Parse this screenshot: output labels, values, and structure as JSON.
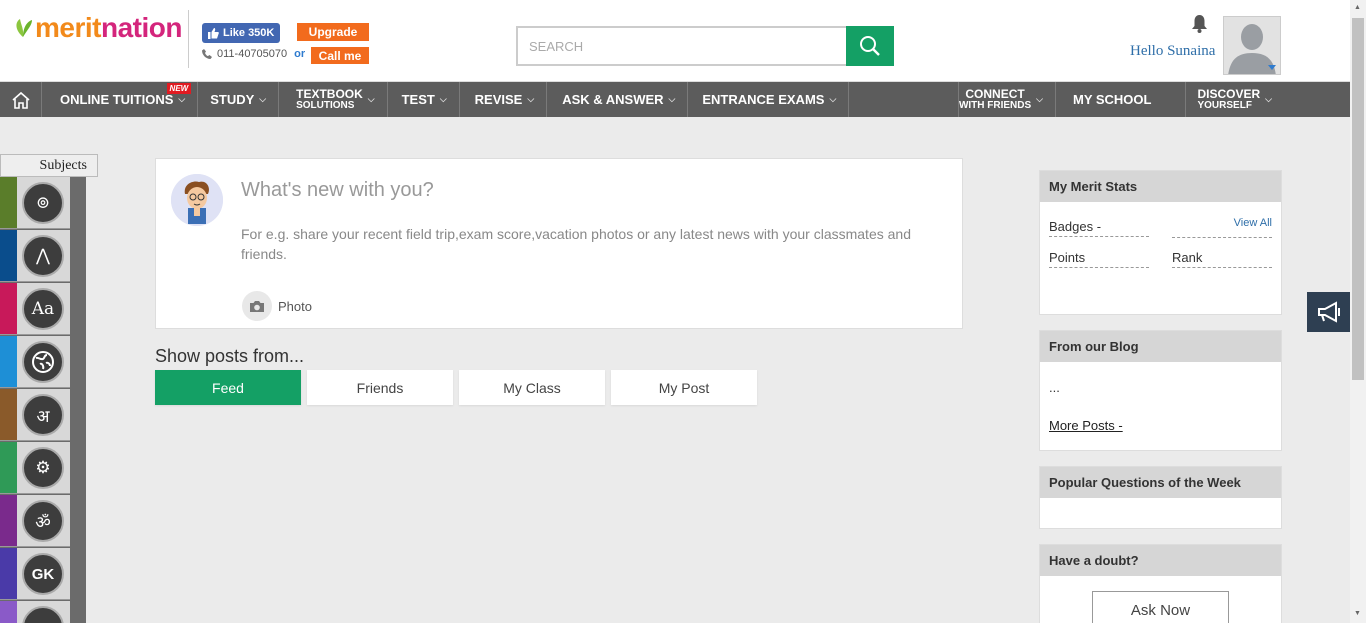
{
  "header": {
    "logo_part1": "merit",
    "logo_part2": "nation",
    "fb_like_label": "Like 350K",
    "upgrade_label": "Upgrade",
    "phone": "011-40705070",
    "or_text": "or",
    "callme_label": "Call me",
    "search_placeholder": "SEARCH",
    "greeting": "Hello Sunaina"
  },
  "nav": {
    "items": [
      {
        "label": "ONLINE TUITIONS",
        "badge": "NEW"
      },
      {
        "label": "STUDY"
      },
      {
        "line1": "TEXTBOOK",
        "line2": "SOLUTIONS"
      },
      {
        "label": "TEST"
      },
      {
        "label": "REVISE"
      },
      {
        "label": "ASK & ANSWER"
      },
      {
        "label": "ENTRANCE EXAMS"
      },
      {
        "line1": "CONNECT",
        "line2": "WITH FRIENDS"
      },
      {
        "label": "MY SCHOOL"
      },
      {
        "line1": "DISCOVER",
        "line2": "YOURSELF"
      }
    ]
  },
  "subjects": {
    "tab_label": "Subjects",
    "items": [
      {
        "icon": "science-icon",
        "stripe": "#5a7d2a",
        "glyph": "⊚"
      },
      {
        "icon": "compass-icon",
        "stripe": "#0a4d8c",
        "glyph": "⋀"
      },
      {
        "icon": "english-icon",
        "stripe": "#c8195a",
        "glyph": "Aa"
      },
      {
        "icon": "globe-icon",
        "stripe": "#1e8fd6",
        "glyph": "🌐"
      },
      {
        "icon": "hindi-icon",
        "stripe": "#8a5a2a",
        "glyph": "अ"
      },
      {
        "icon": "gears-icon",
        "stripe": "#2f9a57",
        "glyph": "⚙"
      },
      {
        "icon": "sanskrit-icon",
        "stripe": "#7a2a8c",
        "glyph": "ॐ"
      },
      {
        "icon": "gk-icon",
        "stripe": "#4a3aa8",
        "glyph": "GK"
      },
      {
        "icon": "more-subject-icon",
        "stripe": "#8a5ac8",
        "glyph": ""
      }
    ]
  },
  "composer": {
    "title": "What's new with you?",
    "hint": "For e.g. share your recent field trip,exam score,vacation photos or any latest news with your classmates and friends.",
    "photo_label": "Photo"
  },
  "feed": {
    "heading": "Show posts from...",
    "tabs": [
      "Feed",
      "Friends",
      "My Class",
      "My Post"
    ],
    "active_tab": "Feed"
  },
  "sidebar": {
    "stats_title": "My Merit Stats",
    "badges_label": "Badges -",
    "view_all": "View All",
    "points_label": "Points",
    "rank_label": "Rank",
    "blog_title": "From our Blog",
    "blog_snippet": "...",
    "more_posts": "More Posts -",
    "popular_title": "Popular Questions of the Week",
    "doubt_title": "Have a doubt?",
    "ask_now": "Ask Now"
  },
  "colors": {
    "accent_green": "#14a065",
    "nav_bg": "#5c5c5c",
    "orange": "#f26b1d",
    "link_blue": "#2e6ea8"
  }
}
